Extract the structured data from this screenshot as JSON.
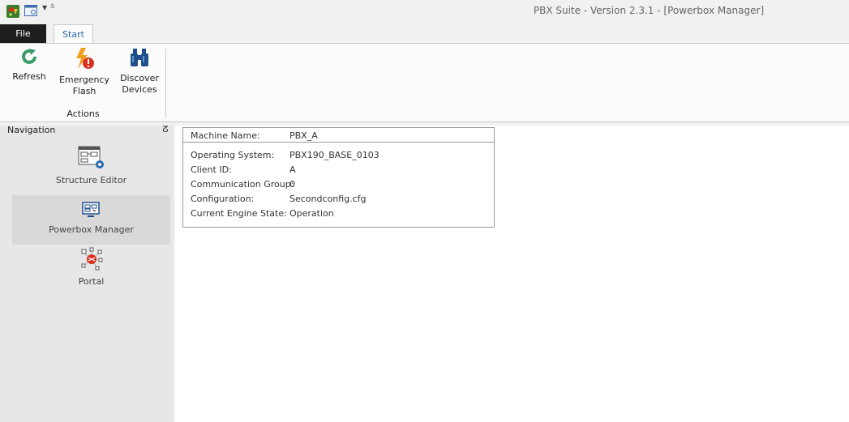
{
  "window": {
    "title": "PBX Suite - Version 2.3.1 - [Powerbox Manager]",
    "qat_customize_glyph": "⩯"
  },
  "tabs": [
    {
      "label": "File"
    },
    {
      "label": "Start"
    }
  ],
  "ribbon": {
    "buttons": [
      {
        "line1": "Refresh",
        "line2": "",
        "icon": "refresh-icon"
      },
      {
        "line1": "Emergency",
        "line2": "Flash",
        "icon": "emergency-flash-icon"
      },
      {
        "line1": "Discover",
        "line2": "Devices",
        "icon": "binoculars-icon"
      }
    ],
    "group_label": "Actions"
  },
  "navigation": {
    "title": "Navigation",
    "pin_glyph": "ⵒ",
    "items": [
      {
        "label": "Structure Editor",
        "icon": "structure-editor-icon"
      },
      {
        "label": "Powerbox Manager",
        "icon": "powerbox-manager-icon",
        "selected": true
      },
      {
        "label": "Portal",
        "icon": "portal-icon"
      }
    ]
  },
  "machine_info": {
    "header": {
      "label": "Machine Name:",
      "value": "PBX_A"
    },
    "rows": [
      {
        "label": "Operating System:",
        "value": "PBX190_BASE_0103"
      },
      {
        "label": "Client ID:",
        "value": "A"
      },
      {
        "label": "Communication Group:",
        "value": "0"
      },
      {
        "label": "Configuration:",
        "value": "Secondconfig.cfg"
      },
      {
        "label": "Current Engine State:",
        "value": "Operation"
      }
    ]
  },
  "colors": {
    "accent": "#2a6bb8",
    "file_tab": "#1e1e1e",
    "refresh": "#3a9c6a",
    "flash": "#f0a020",
    "warning": "#d9301f",
    "binoculars": "#1f4f8a"
  }
}
